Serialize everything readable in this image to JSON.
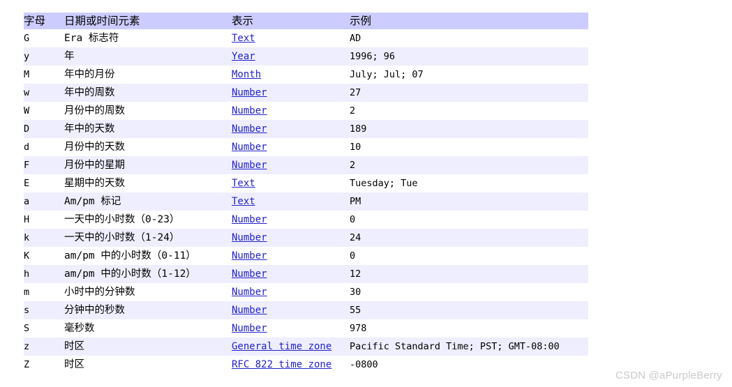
{
  "table": {
    "headers": {
      "letter": "字母",
      "element": "日期或时间元素",
      "presentation": "表示",
      "example": "示例"
    },
    "rows": [
      {
        "letter": "G",
        "element": "Era 标志符",
        "presentation": "Text",
        "example": "AD"
      },
      {
        "letter": "y",
        "element": "年",
        "presentation": "Year",
        "example": "1996; 96"
      },
      {
        "letter": "M",
        "element": "年中的月份",
        "presentation": "Month",
        "example": "July; Jul; 07"
      },
      {
        "letter": "w",
        "element": "年中的周数",
        "presentation": "Number",
        "example": "27"
      },
      {
        "letter": "W",
        "element": "月份中的周数",
        "presentation": "Number",
        "example": "2"
      },
      {
        "letter": "D",
        "element": "年中的天数",
        "presentation": "Number",
        "example": "189"
      },
      {
        "letter": "d",
        "element": "月份中的天数",
        "presentation": "Number",
        "example": "10"
      },
      {
        "letter": "F",
        "element": "月份中的星期",
        "presentation": "Number",
        "example": "2"
      },
      {
        "letter": "E",
        "element": "星期中的天数",
        "presentation": "Text",
        "example": "Tuesday; Tue"
      },
      {
        "letter": "a",
        "element": "Am/pm 标记",
        "presentation": "Text",
        "example": "PM"
      },
      {
        "letter": "H",
        "element": "一天中的小时数（0-23）",
        "presentation": "Number",
        "example": "0"
      },
      {
        "letter": "k",
        "element": "一天中的小时数（1-24）",
        "presentation": "Number",
        "example": "24"
      },
      {
        "letter": "K",
        "element": "am/pm 中的小时数（0-11）",
        "presentation": "Number",
        "example": "0"
      },
      {
        "letter": "h",
        "element": "am/pm 中的小时数（1-12）",
        "presentation": "Number",
        "example": "12"
      },
      {
        "letter": "m",
        "element": "小时中的分钟数",
        "presentation": "Number",
        "example": "30"
      },
      {
        "letter": "s",
        "element": "分钟中的秒数",
        "presentation": "Number",
        "example": "55"
      },
      {
        "letter": "S",
        "element": "毫秒数",
        "presentation": "Number",
        "example": "978"
      },
      {
        "letter": "z",
        "element": "时区",
        "presentation": "General time zone",
        "example": "Pacific Standard Time; PST; GMT-08:00"
      },
      {
        "letter": "Z",
        "element": "时区",
        "presentation": "RFC 822 time zone",
        "example": "-0800"
      }
    ]
  },
  "watermark": {
    "text": "CSDN @aPurpleBerry"
  },
  "colors": {
    "header_background": "#ccccff",
    "stripe_background": "#eeeeff",
    "row_background": "#ffffff",
    "link": "#2222cc",
    "text": "#000000",
    "watermark": "#c9c9c9"
  }
}
